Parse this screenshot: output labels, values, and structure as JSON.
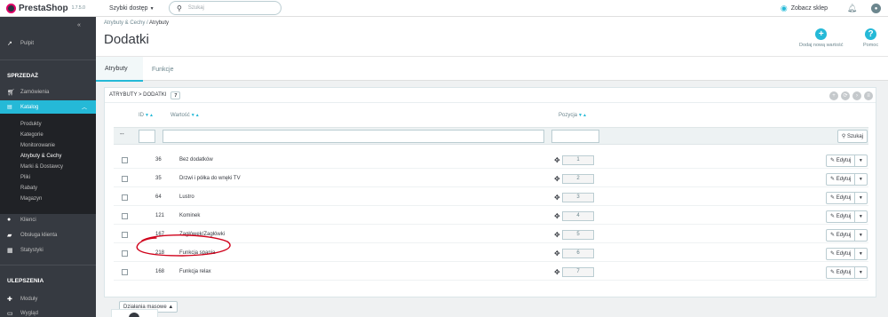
{
  "header": {
    "brand": "PrestaShop",
    "version": "1.7.5.0",
    "quick_access": "Szybki dostęp",
    "search_placeholder": "Szukaj",
    "view_shop": "Zobacz sklep"
  },
  "sidebar": {
    "dashboard": "Pulpit",
    "section_sales": "SPRZEDAŻ",
    "orders": "Zamówienia",
    "catalog": "Katalog",
    "catalog_items": [
      "Produkty",
      "Kategorie",
      "Monitorowanie",
      "Atrybuty & Cechy",
      "Marki & Dostawcy",
      "Pliki",
      "Rabaty",
      "Magazyn"
    ],
    "customers": "Klienci",
    "customer_service": "Obsługa klienta",
    "stats": "Statystyki",
    "section_improve": "ULEPSZENIA",
    "modules": "Moduły",
    "design": "Wygląd"
  },
  "page": {
    "breadcrumb_parent": "Atrybuty & Cechy",
    "breadcrumb_current": "Atrybuty",
    "title": "Dodatki",
    "add_value": "Dodaj nową wartość",
    "help": "Pomoc",
    "tabs": [
      "Atrybuty",
      "Funkcje"
    ]
  },
  "panel": {
    "title": "ATRYBUTY > DODATKI",
    "count": "7",
    "col_id": "ID",
    "col_value": "Wartość",
    "col_position": "Pozycja",
    "search_button": "Szukaj",
    "edit_label": "Edytuj",
    "bulk_actions": "Działania masowe",
    "filter_dash": "--"
  },
  "rows": [
    {
      "id": "36",
      "value": "Bez dodatków",
      "position": "1"
    },
    {
      "id": "35",
      "value": "Drzwi i półka do wnęki TV",
      "position": "2"
    },
    {
      "id": "64",
      "value": "Lustro",
      "position": "3"
    },
    {
      "id": "121",
      "value": "Kominek",
      "position": "4"
    },
    {
      "id": "167",
      "value": "Zagłówek/Zagłówki",
      "position": "5"
    },
    {
      "id": "218",
      "value": "Funkcja spania",
      "position": "6"
    },
    {
      "id": "168",
      "value": "Funkcja relax",
      "position": "7"
    }
  ],
  "colors": {
    "accent": "#25b9d7",
    "sidebar": "#363a41",
    "annotation": "#d0021b"
  }
}
